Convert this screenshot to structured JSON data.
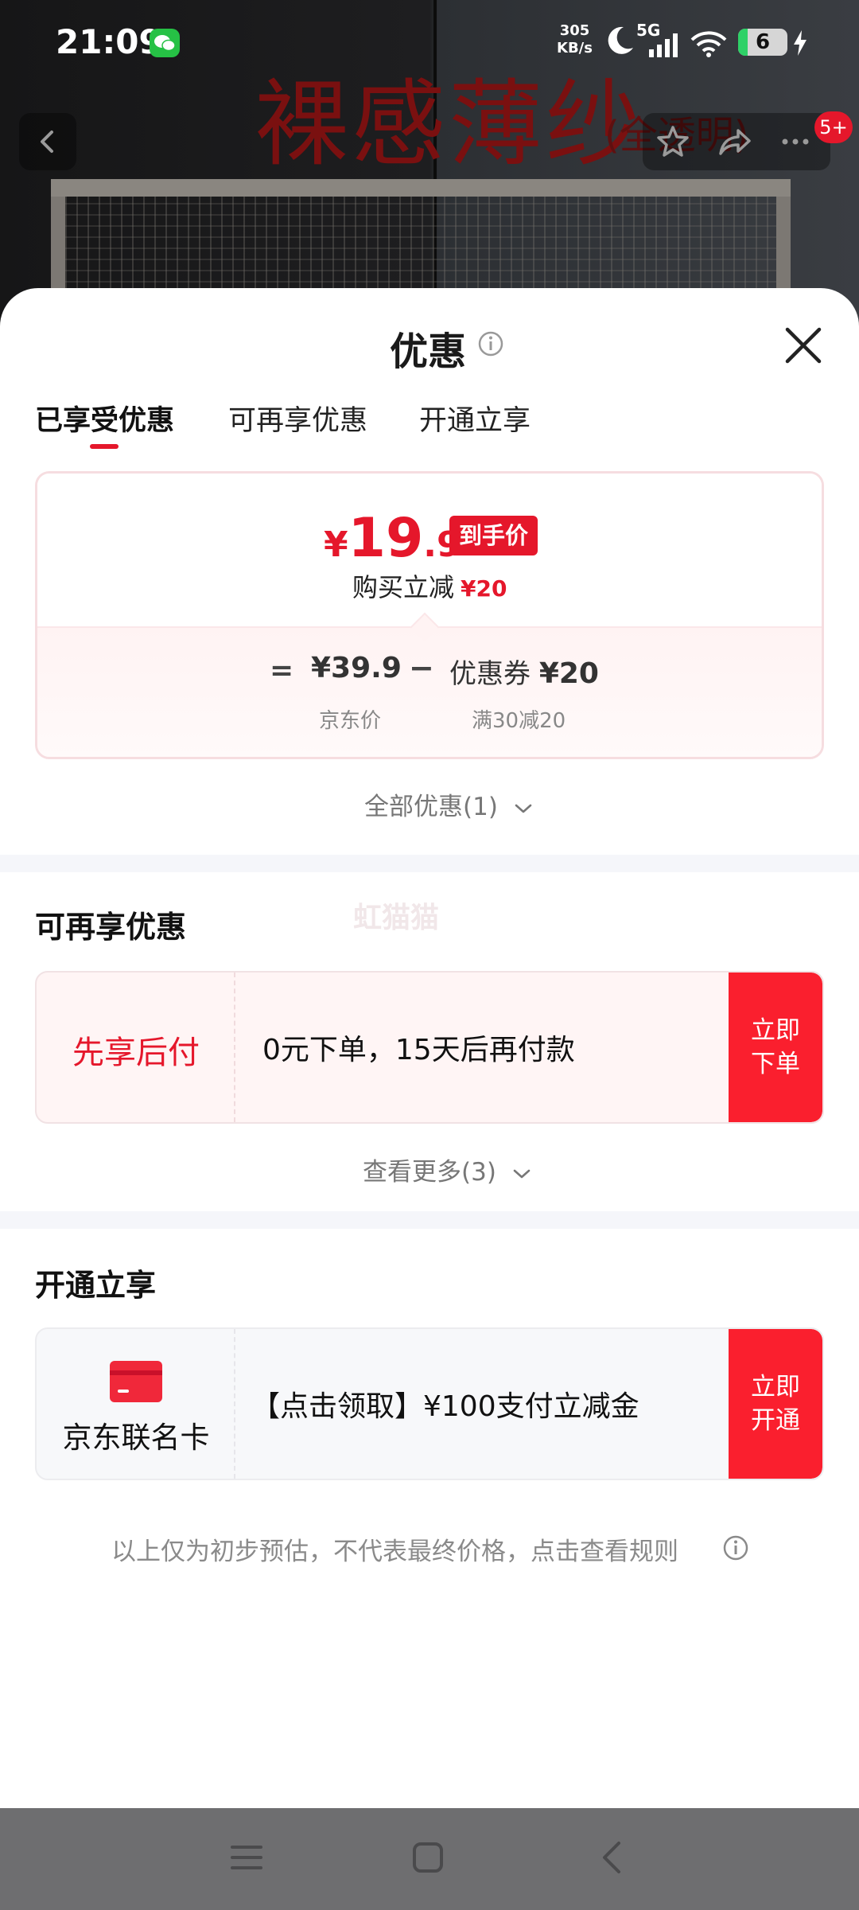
{
  "status_bar": {
    "time": "21:09",
    "speed_value": "305",
    "speed_unit": "KB/s",
    "network": "5G",
    "battery": "6"
  },
  "background": {
    "banner_text": "裸感薄纱",
    "banner_sub": "(全透明)",
    "badge": "5+"
  },
  "sheet": {
    "title": "优惠",
    "tabs": [
      {
        "label": "已享受优惠",
        "active": true
      },
      {
        "label": "可再享优惠",
        "active": false
      },
      {
        "label": "开通立享",
        "active": false
      }
    ],
    "price_card": {
      "currency": "¥",
      "price_int": "19",
      "price_dec": ".9",
      "tag": "到手价",
      "save_label": "购买立减",
      "save_amount": "¥20",
      "calc": {
        "eq": "=",
        "price": "¥39.9",
        "minus": "−",
        "coupon_label": "优惠券",
        "coupon_amount": "¥20",
        "price_caption": "京东价",
        "coupon_caption": "满30减20"
      }
    },
    "all_offers_link": "全部优惠(1)",
    "more_section": {
      "title": "可再享优惠",
      "watermark": "虹猫猫",
      "offer": {
        "label": "先享后付",
        "desc": "0元下单，15天后再付款",
        "button_line1": "立即",
        "button_line2": "下单"
      },
      "more_link": "查看更多(3)"
    },
    "open_section": {
      "title": "开通立享",
      "offer": {
        "label": "京东联名卡",
        "desc": "【点击领取】¥100支付立减金",
        "button_line1": "立即",
        "button_line2": "开通"
      }
    },
    "footnote": "以上仅为初步预估，不代表最终价格，点击查看规则"
  },
  "colors": {
    "accent": "#e5172b",
    "button": "#fa1f2e",
    "muted_text": "#888888"
  },
  "icons": {
    "info": "info-circle-icon",
    "close": "close-icon",
    "chevron": "chevron-down-icon",
    "card": "credit-card-icon"
  }
}
